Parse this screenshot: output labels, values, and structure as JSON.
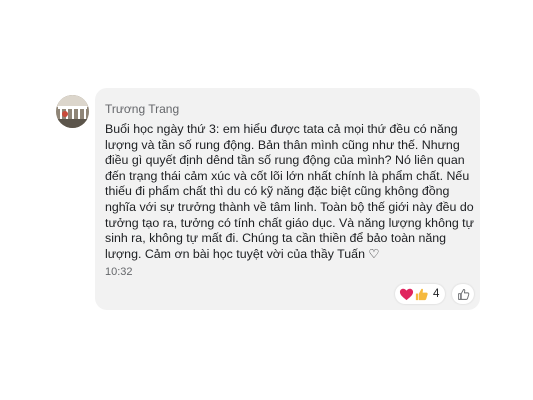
{
  "comment": {
    "author": "Trương Trang",
    "message": "Buổi học ngày thứ 3: em hiểu được tata cả mọi thứ đều có năng lượng và tần số rung động. Bản thân mình cũng như thế. Nhưng điều gì quyết định dênd tần số rung động của mình? Nó liên quan đến trạng thái cảm xúc và cốt lõi lớn nhất chính là phẩm chất. Nếu thiếu đi phẩm chất thì du có kỹ năng đặc biệt cũng không đồng nghĩa với sự trưởng thành về tâm linh. Toàn bộ thế giới này đều do tưởng tạo ra, tưởng có tính chất giáo dục. Và năng lượng không tự sinh ra, không tự mất đi. Chúng ta cần thiền để bảo toàn năng lượng. Cảm ơn bài học tuyệt vời của thầy Tuấn ♡",
    "time": "10:32",
    "reactions": {
      "icons": [
        "heart-icon",
        "thumbs-up-icon"
      ],
      "count": "4"
    },
    "like_button_icon": "thumbs-up-outline-icon"
  },
  "colors": {
    "bubble_bg": "#f2f2f2",
    "text": "#1c1e21",
    "meta": "#65676b",
    "heart": "#e0245e",
    "like": "#f5b93f"
  }
}
